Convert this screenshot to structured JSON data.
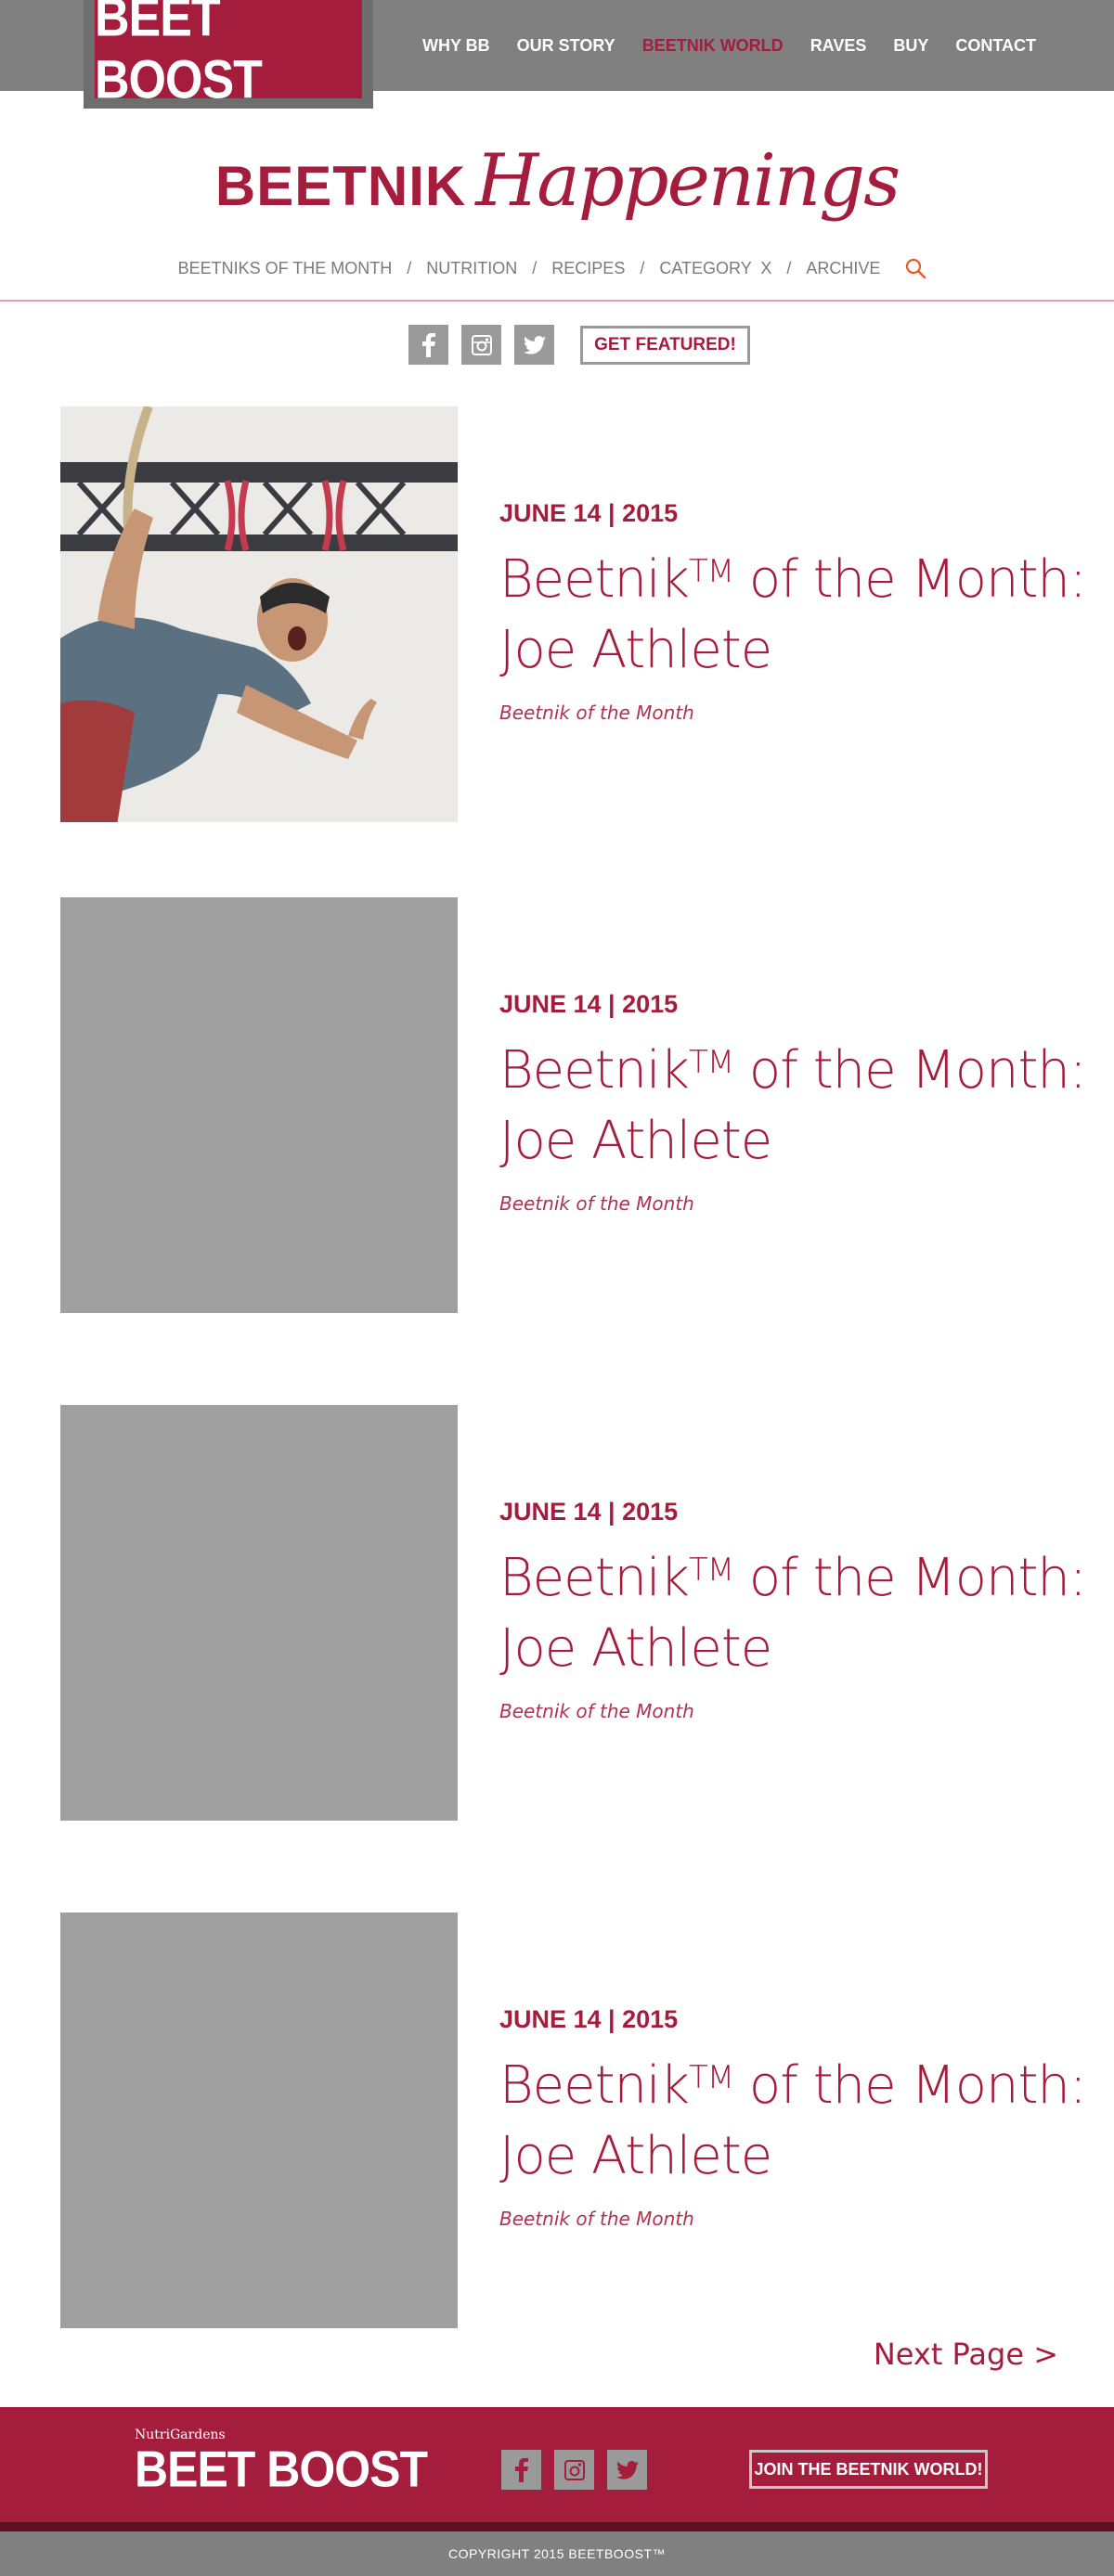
{
  "brand": {
    "logo_text": "BEET BOOST"
  },
  "nav": {
    "items": [
      {
        "label": "WHY BB"
      },
      {
        "label": "OUR STORY"
      },
      {
        "label": "BEETNIK WORLD",
        "active": true
      },
      {
        "label": "RAVES"
      },
      {
        "label": "BUY"
      },
      {
        "label": "CONTACT"
      }
    ]
  },
  "section": {
    "title_bold": "BEETNIK",
    "title_script": "Happenings"
  },
  "subnav": {
    "items": [
      {
        "label": "BEETNIKS OF THE MONTH"
      },
      {
        "label": "NUTRITION"
      },
      {
        "label": "RECIPES"
      },
      {
        "label": "CATEGORY  X"
      },
      {
        "label": "ARCHIVE"
      }
    ],
    "separator": "/",
    "search_icon": "search-icon"
  },
  "social": {
    "icons": [
      "facebook-icon",
      "instagram-icon",
      "twitter-icon"
    ],
    "cta_label": "GET FEATURED!"
  },
  "posts": [
    {
      "date": "JUNE 14 | 2015",
      "title_pre": "Beetnik",
      "tm": "TM",
      "title_post": " of the Month: Joe Athlete",
      "category": "Beetnik of the Month",
      "has_photo": true
    },
    {
      "date": "JUNE 14 | 2015",
      "title_pre": "Beetnik",
      "tm": "TM",
      "title_post": " of the Month: Joe Athlete",
      "category": "Beetnik of the Month",
      "has_photo": false
    },
    {
      "date": "JUNE 14 | 2015",
      "title_pre": "Beetnik",
      "tm": "TM",
      "title_post": " of the Month: Joe Athlete",
      "category": "Beetnik of the Month",
      "has_photo": false
    },
    {
      "date": "JUNE 14 | 2015",
      "title_pre": "Beetnik",
      "tm": "TM",
      "title_post": " of the Month: Joe Athlete",
      "category": "Beetnik of the Month",
      "has_photo": false
    }
  ],
  "pagination": {
    "next_label": "Next Page >"
  },
  "footer": {
    "small_brand": "NutriGardens",
    "logo_text": "BEET BOOST",
    "join_label": "JOIN THE BEETNIK WORLD!",
    "copyright": "COPYRIGHT 2015 BEETBOOST™"
  },
  "colors": {
    "brand": "#a51d3c",
    "gray_bar": "#808080",
    "placeholder": "#a0a0a0",
    "footer_dark": "#5e0f22"
  }
}
